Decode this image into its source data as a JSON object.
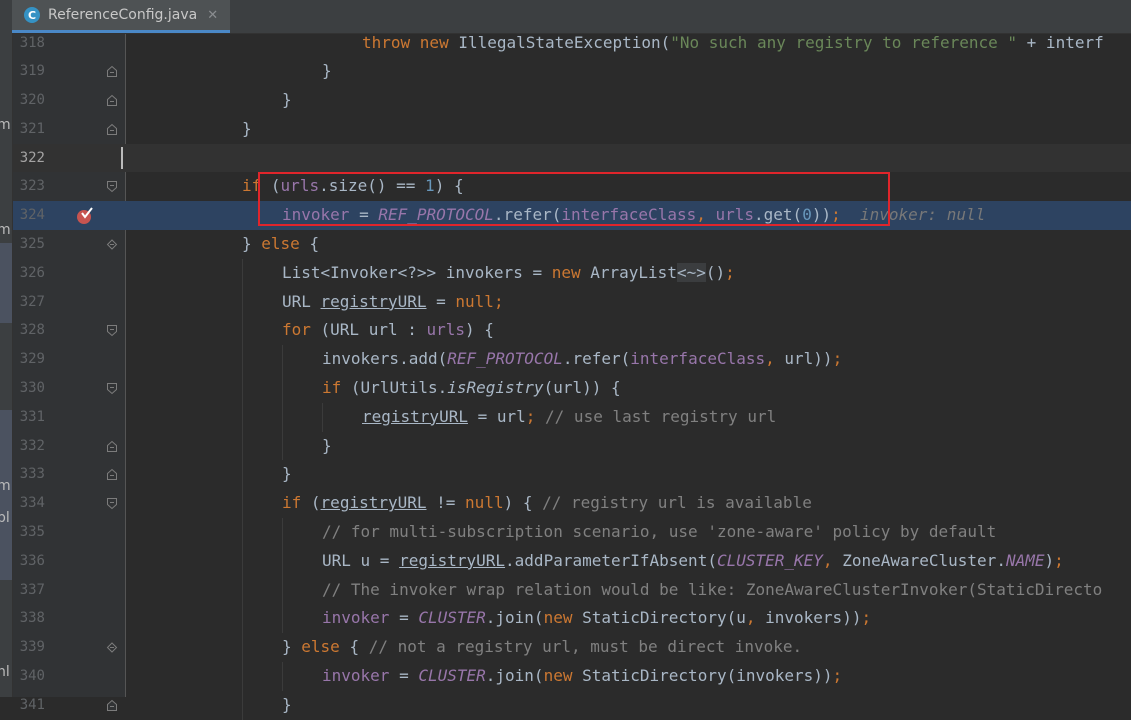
{
  "tab": {
    "file_name": "ReferenceConfig.java",
    "icon_letter": "C",
    "close_glyph": "✕"
  },
  "side_panel": {
    "fragments": [
      "·",
      "m",
      "m",
      "m",
      "pl",
      "nl"
    ]
  },
  "code_lines": [
    {
      "n": "318",
      "tokens": [
        [
          "kw",
          "throw "
        ],
        [
          "kw",
          "new "
        ],
        [
          "",
          "IllegalStateException("
        ],
        [
          "str",
          "\"No such any registry to reference \""
        ],
        [
          "",
          " + interf"
        ]
      ]
    },
    {
      "n": "319",
      "tokens": [
        [
          "",
          "}"
        ]
      ]
    },
    {
      "n": "320",
      "tokens": [
        [
          "",
          "}"
        ]
      ]
    },
    {
      "n": "321",
      "tokens": [
        [
          "",
          "}"
        ]
      ]
    },
    {
      "n": "322",
      "tokens": []
    },
    {
      "n": "323",
      "tokens": [
        [
          "kw",
          "if "
        ],
        [
          "",
          "("
        ],
        [
          "fld",
          "urls"
        ],
        [
          "",
          ".size() == "
        ],
        [
          "num",
          "1"
        ],
        [
          "",
          ") {"
        ]
      ]
    },
    {
      "n": "324",
      "tokens": [
        [
          "fld",
          "invoker "
        ],
        [
          "",
          "= "
        ],
        [
          "cst",
          "REF_PROTOCOL"
        ],
        [
          "",
          ".refer("
        ],
        [
          "fld",
          "interfaceClass"
        ],
        [
          "kw",
          ", "
        ],
        [
          "fld",
          "urls"
        ],
        [
          "",
          ".get("
        ],
        [
          "num",
          "0"
        ],
        [
          "",
          "))"
        ],
        [
          "kw",
          ";"
        ],
        [
          "",
          "  "
        ],
        [
          "hint",
          "invoker: null"
        ]
      ]
    },
    {
      "n": "325",
      "tokens": [
        [
          "",
          "} "
        ],
        [
          "kw",
          "else "
        ],
        [
          "",
          "{"
        ]
      ]
    },
    {
      "n": "326",
      "tokens": [
        [
          "",
          "List<Invoker<?>> invokers = "
        ],
        [
          "kw",
          "new "
        ],
        [
          "",
          "ArrayList"
        ],
        [
          "dim",
          "<~>"
        ],
        [
          "",
          "()"
        ],
        [
          "kw",
          ";"
        ]
      ]
    },
    {
      "n": "327",
      "tokens": [
        [
          "",
          "URL "
        ],
        [
          "ul",
          "registryURL"
        ],
        [
          "",
          " = "
        ],
        [
          "kw",
          "null;"
        ]
      ]
    },
    {
      "n": "328",
      "tokens": [
        [
          "kw",
          "for "
        ],
        [
          "",
          "(URL url : "
        ],
        [
          "fld",
          "urls"
        ],
        [
          "",
          ") {"
        ]
      ]
    },
    {
      "n": "329",
      "tokens": [
        [
          "",
          "invokers.add("
        ],
        [
          "cst",
          "REF_PROTOCOL"
        ],
        [
          "",
          ".refer("
        ],
        [
          "fld",
          "interfaceClass"
        ],
        [
          "kw",
          ", "
        ],
        [
          "",
          "url))"
        ],
        [
          "kw",
          ";"
        ]
      ]
    },
    {
      "n": "330",
      "tokens": [
        [
          "kw",
          "if "
        ],
        [
          "",
          "(UrlUtils."
        ],
        [
          "mst",
          "isRegistry"
        ],
        [
          "",
          "(url)) {"
        ]
      ]
    },
    {
      "n": "331",
      "tokens": [
        [
          "ul",
          "registryURL"
        ],
        [
          "",
          " = url"
        ],
        [
          "kw",
          "; "
        ],
        [
          "cmt",
          "// use last registry url"
        ]
      ]
    },
    {
      "n": "332",
      "tokens": [
        [
          "",
          "}"
        ]
      ]
    },
    {
      "n": "333",
      "tokens": [
        [
          "",
          "}"
        ]
      ]
    },
    {
      "n": "334",
      "tokens": [
        [
          "kw",
          "if "
        ],
        [
          "",
          "("
        ],
        [
          "ul",
          "registryURL"
        ],
        [
          "",
          " != "
        ],
        [
          "kw",
          "null"
        ],
        [
          "",
          ") { "
        ],
        [
          "cmt",
          "// registry url is available"
        ]
      ]
    },
    {
      "n": "335",
      "tokens": [
        [
          "cmt",
          "// for multi-subscription scenario, use 'zone-aware' policy by default"
        ]
      ]
    },
    {
      "n": "336",
      "tokens": [
        [
          "",
          "URL u = "
        ],
        [
          "ul",
          "registryURL"
        ],
        [
          "",
          ".addParameterIfAbsent("
        ],
        [
          "cst",
          "CLUSTER_KEY"
        ],
        [
          "kw",
          ", "
        ],
        [
          "",
          "ZoneAwareCluster."
        ],
        [
          "cst",
          "NAME"
        ],
        [
          "",
          ")"
        ],
        [
          "kw",
          ";"
        ]
      ]
    },
    {
      "n": "337",
      "tokens": [
        [
          "cmt",
          "// The invoker wrap relation would be like: ZoneAwareClusterInvoker(StaticDirecto"
        ]
      ]
    },
    {
      "n": "338",
      "tokens": [
        [
          "fld",
          "invoker "
        ],
        [
          "",
          "= "
        ],
        [
          "cst",
          "CLUSTER"
        ],
        [
          "",
          ".join("
        ],
        [
          "kw",
          "new "
        ],
        [
          "",
          "StaticDirectory(u"
        ],
        [
          "kw",
          ", "
        ],
        [
          "",
          "invokers))"
        ],
        [
          "kw",
          ";"
        ]
      ]
    },
    {
      "n": "339",
      "tokens": [
        [
          "",
          "} "
        ],
        [
          "kw",
          "else "
        ],
        [
          "",
          "{ "
        ],
        [
          "cmt",
          "// not a registry url, must be direct invoke."
        ]
      ]
    },
    {
      "n": "340",
      "tokens": [
        [
          "fld",
          "invoker "
        ],
        [
          "",
          "= "
        ],
        [
          "cst",
          "CLUSTER"
        ],
        [
          "",
          ".join("
        ],
        [
          "kw",
          "new "
        ],
        [
          "",
          "StaticDirectory(invokers))"
        ],
        [
          "kw",
          ";"
        ]
      ]
    },
    {
      "n": "341",
      "tokens": [
        [
          "",
          "}"
        ]
      ]
    }
  ],
  "colors": {
    "keyword": "#cc7832",
    "number": "#6897bb",
    "constant": "#9876aa",
    "comment": "#808080",
    "string": "#6a8759",
    "breakpoint_line": "#2d4361",
    "annotation_box": "#e0252b"
  },
  "icons": {
    "tab_icon": "java-class-icon",
    "breakpoint": "breakpoint-checked-icon",
    "fold": "fold-marker-icon"
  }
}
